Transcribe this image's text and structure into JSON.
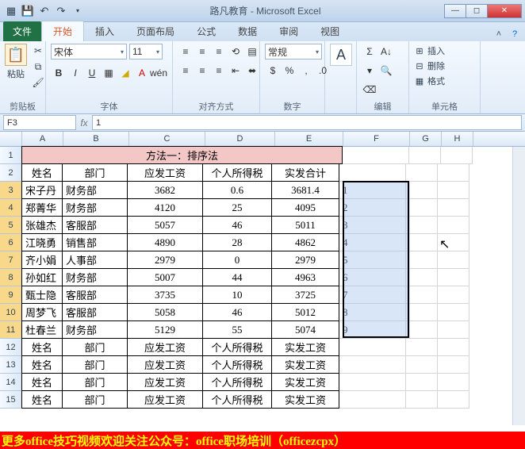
{
  "title": "路凡教育 - Microsoft Excel",
  "qat": {
    "save": "💾",
    "undo": "↶",
    "redo": "↷"
  },
  "tabs": {
    "file": "文件",
    "home": "开始",
    "insert": "插入",
    "layout": "页面布局",
    "formulas": "公式",
    "data": "数据",
    "review": "审阅",
    "view": "视图"
  },
  "ribbon": {
    "clipboard": {
      "label": "剪贴板",
      "paste": "粘贴"
    },
    "font": {
      "label": "字体",
      "name": "宋体",
      "size": "11"
    },
    "align": {
      "label": "对齐方式"
    },
    "number": {
      "label": "数字",
      "format": "常规"
    },
    "edit": {
      "label": "编辑"
    },
    "cells": {
      "label": "单元格",
      "insert": "插入",
      "delete": "删除",
      "format": "格式"
    }
  },
  "namebox": "F3",
  "formula": "1",
  "cols": {
    "A": 52,
    "B": 83,
    "C": 96,
    "D": 88,
    "E": 86,
    "F": 84,
    "G": 40,
    "H": 40
  },
  "sheet": {
    "title": "方法一：排序法",
    "headers": [
      "姓名",
      "部门",
      "应发工资",
      "个人所得税",
      "实发合计"
    ],
    "headers2": [
      "姓名",
      "部门",
      "应发工资",
      "个人所得税",
      "实发工资"
    ],
    "rows": [
      {
        "name": "宋子丹",
        "dept": "财务部",
        "pay": "3682",
        "tax": "0.6",
        "net": "3681.4",
        "f": "1"
      },
      {
        "name": "郑菁华",
        "dept": "财务部",
        "pay": "4120",
        "tax": "25",
        "net": "4095",
        "f": "2"
      },
      {
        "name": "张雄杰",
        "dept": "客服部",
        "pay": "5057",
        "tax": "46",
        "net": "5011",
        "f": "3"
      },
      {
        "name": "江晓勇",
        "dept": "销售部",
        "pay": "4890",
        "tax": "28",
        "net": "4862",
        "f": "4"
      },
      {
        "name": "齐小娟",
        "dept": "人事部",
        "pay": "2979",
        "tax": "0",
        "net": "2979",
        "f": "5"
      },
      {
        "name": "孙如红",
        "dept": "财务部",
        "pay": "5007",
        "tax": "44",
        "net": "4963",
        "f": "6"
      },
      {
        "name": "甄士隐",
        "dept": "客服部",
        "pay": "3735",
        "tax": "10",
        "net": "3725",
        "f": "7"
      },
      {
        "name": "周梦飞",
        "dept": "客服部",
        "pay": "5058",
        "tax": "46",
        "net": "5012",
        "f": "8"
      },
      {
        "name": "杜春兰",
        "dept": "财务部",
        "pay": "5129",
        "tax": "55",
        "net": "5074",
        "f": "9"
      }
    ],
    "extraHeaderRows": 4
  },
  "footer": "更多office技巧视频欢迎关注公众号：office职场培训（officezcpx）"
}
